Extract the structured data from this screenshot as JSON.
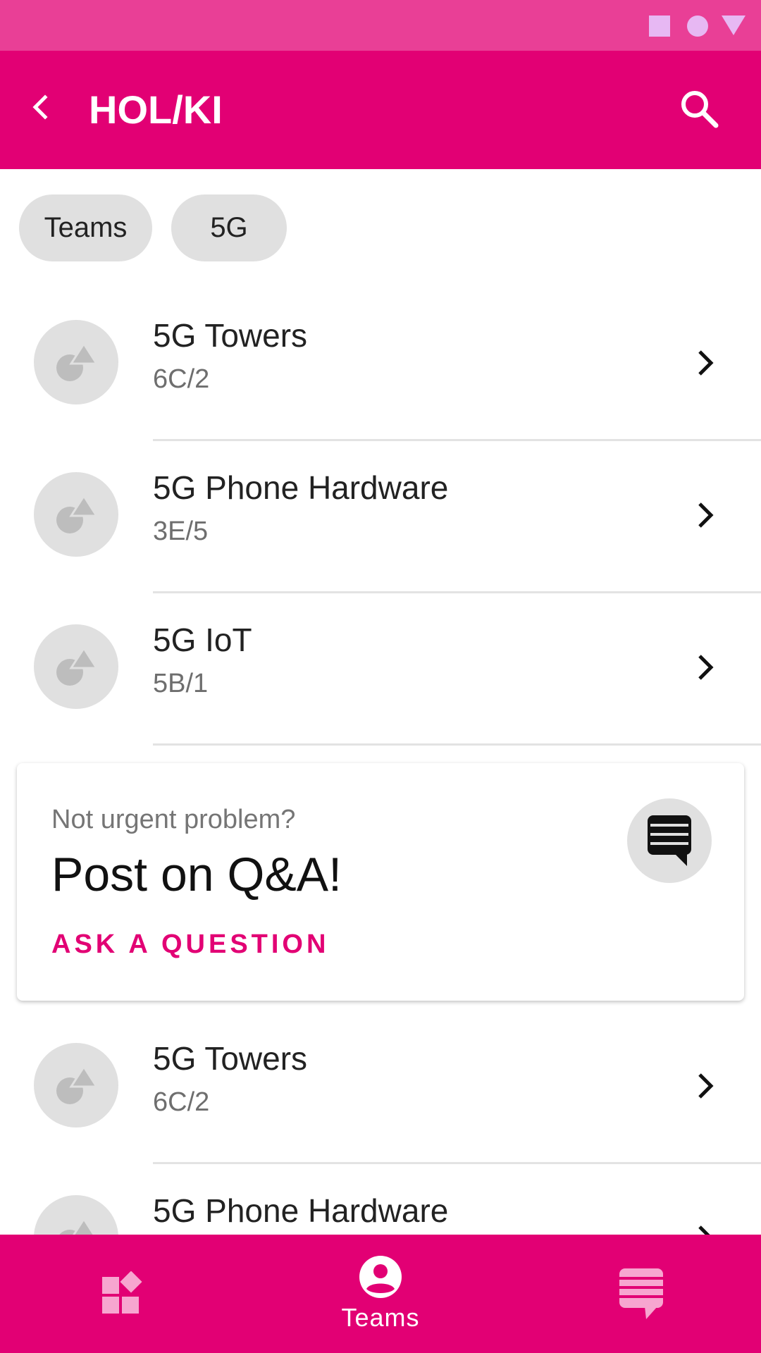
{
  "app_bar": {
    "title": "HOL/KI",
    "back_icon": "chevron-left-icon",
    "search_icon": "search-icon"
  },
  "filters": [
    {
      "label": "Teams"
    },
    {
      "label": "5G"
    }
  ],
  "teams_top": [
    {
      "name": "5G Towers",
      "location": "6C/2"
    },
    {
      "name": "5G Phone Hardware",
      "location": "3E/5"
    },
    {
      "name": "5G IoT",
      "location": "5B/1"
    }
  ],
  "qa_card": {
    "kicker": "Not urgent problem?",
    "headline": "Post on Q&A!",
    "action_label": "ASK A QUESTION",
    "icon": "chat-bubble-icon"
  },
  "teams_bottom": [
    {
      "name": "5G Towers",
      "location": "6C/2"
    },
    {
      "name": "5G Phone Hardware",
      "location": ""
    }
  ],
  "bottom_nav": {
    "items": [
      {
        "icon": "apps-icon",
        "label": ""
      },
      {
        "icon": "account-circle-icon",
        "label": "Teams"
      },
      {
        "icon": "forum-icon",
        "label": ""
      }
    ]
  },
  "colors": {
    "brand": "#e20074",
    "status_bar": "#e93f96",
    "chip": "#e0e0e0"
  }
}
